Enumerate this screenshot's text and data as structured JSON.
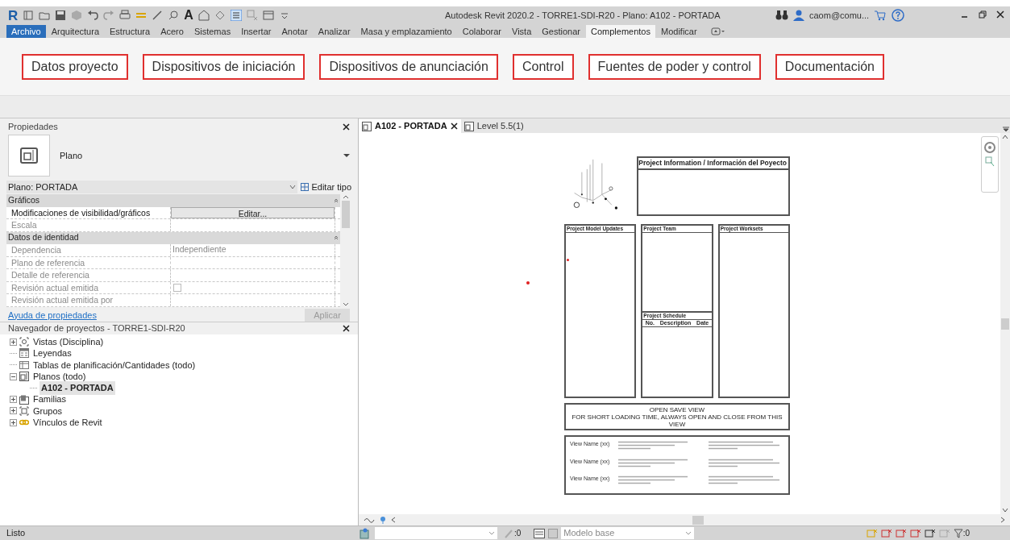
{
  "quick_access": {
    "logo": "R",
    "text_tool": "A"
  },
  "window": {
    "title": "Autodesk Revit 2020.2 - TORRE1-SDI-R20 - Plano: A102 - PORTADA",
    "user": "caom@comu..."
  },
  "ribbon_tabs": [
    {
      "label": "Archivo",
      "kind": "app",
      "selected": false
    },
    {
      "label": "Arquitectura",
      "kind": "tab",
      "selected": false
    },
    {
      "label": "Estructura",
      "kind": "tab",
      "selected": false
    },
    {
      "label": "Acero",
      "kind": "tab",
      "selected": false
    },
    {
      "label": "Sistemas",
      "kind": "tab",
      "selected": false
    },
    {
      "label": "Insertar",
      "kind": "tab",
      "selected": false
    },
    {
      "label": "Anotar",
      "kind": "tab",
      "selected": false
    },
    {
      "label": "Analizar",
      "kind": "tab",
      "selected": false
    },
    {
      "label": "Masa y emplazamiento",
      "kind": "tab",
      "selected": false
    },
    {
      "label": "Colaborar",
      "kind": "tab",
      "selected": false
    },
    {
      "label": "Vista",
      "kind": "tab",
      "selected": false
    },
    {
      "label": "Gestionar",
      "kind": "tab",
      "selected": false
    },
    {
      "label": "Complementos",
      "kind": "tab",
      "selected": true
    },
    {
      "label": "Modificar",
      "kind": "tab",
      "selected": false
    }
  ],
  "ribbon_buttons": [
    "Datos proyecto",
    "Dispositivos de iniciación",
    "Dispositivos de anunciación",
    "Control",
    "Fuentes de poder y control",
    "Documentación"
  ],
  "properties": {
    "title": "Propiedades",
    "type_name": "Plano",
    "instance": "Plano: PORTADA",
    "edit_type": "Editar tipo",
    "groups": [
      {
        "name": "Gráficos",
        "rows": [
          {
            "label": "Modificaciones de visibilidad/gráficos",
            "kind": "button",
            "value": "Editar...",
            "disabled": false
          },
          {
            "label": "Escala",
            "kind": "text",
            "disabled": true
          }
        ]
      },
      {
        "name": "Datos de identidad",
        "rows": [
          {
            "label": "Dependencia",
            "kind": "text",
            "value": "Independiente",
            "disabled": true
          },
          {
            "label": "Plano de referencia",
            "kind": "text",
            "disabled": true
          },
          {
            "label": "Detalle de referencia",
            "kind": "text",
            "disabled": true
          },
          {
            "label": "Revisión actual emitida",
            "kind": "checkbox",
            "checked": false,
            "disabled": true
          },
          {
            "label": "Revisión actual emitida por",
            "kind": "text",
            "disabled": true
          }
        ]
      }
    ],
    "help_link": "Ayuda de propiedades",
    "apply_button": {
      "label": "Aplicar",
      "disabled": true
    }
  },
  "browser": {
    "title": "Navegador de proyectos - TORRE1-SDI-R20",
    "items": [
      {
        "label": "Vistas (Disciplina)",
        "kind": "folder",
        "expanded": false
      },
      {
        "label": "Leyendas",
        "kind": "leaf"
      },
      {
        "label": "Tablas de planificación/Cantidades (todo)",
        "kind": "leaf"
      },
      {
        "label": "Planos (todo)",
        "kind": "folder",
        "expanded": true,
        "children": [
          {
            "label": "A102 - PORTADA",
            "kind": "leaf",
            "selected": true
          }
        ]
      },
      {
        "label": "Familias",
        "kind": "folder",
        "expanded": false
      },
      {
        "label": "Grupos",
        "kind": "folder",
        "expanded": false
      },
      {
        "label": "Vínculos de Revit",
        "kind": "folder",
        "expanded": false
      }
    ]
  },
  "view_tabs": [
    {
      "label": "A102 - PORTADA",
      "selected": true
    },
    {
      "label": "Level 5.5(1)",
      "selected": false
    }
  ],
  "sheet": {
    "info_title": "Project Information / Información del Poyecto",
    "model_updates": "Project Model Updates",
    "team": "Project Team",
    "worksets": "Project Worksets",
    "schedule": {
      "title": "Project Schedule",
      "columns": [
        "No.",
        "Description",
        "Date"
      ]
    },
    "notice": [
      "OPEN SAVE VIEW",
      "FOR SHORT LOADING TIME, ALWAYS OPEN AND CLOSE FROM THIS VIEW"
    ],
    "legend": [
      {
        "name": "View Name (xx)"
      },
      {
        "name": "View Name (xx)"
      },
      {
        "name": "View Name (xx)"
      }
    ]
  },
  "status_bar": {
    "text": "Listo",
    "selection_count": ":0",
    "model": "Modelo base",
    "filter_count": ":0"
  }
}
